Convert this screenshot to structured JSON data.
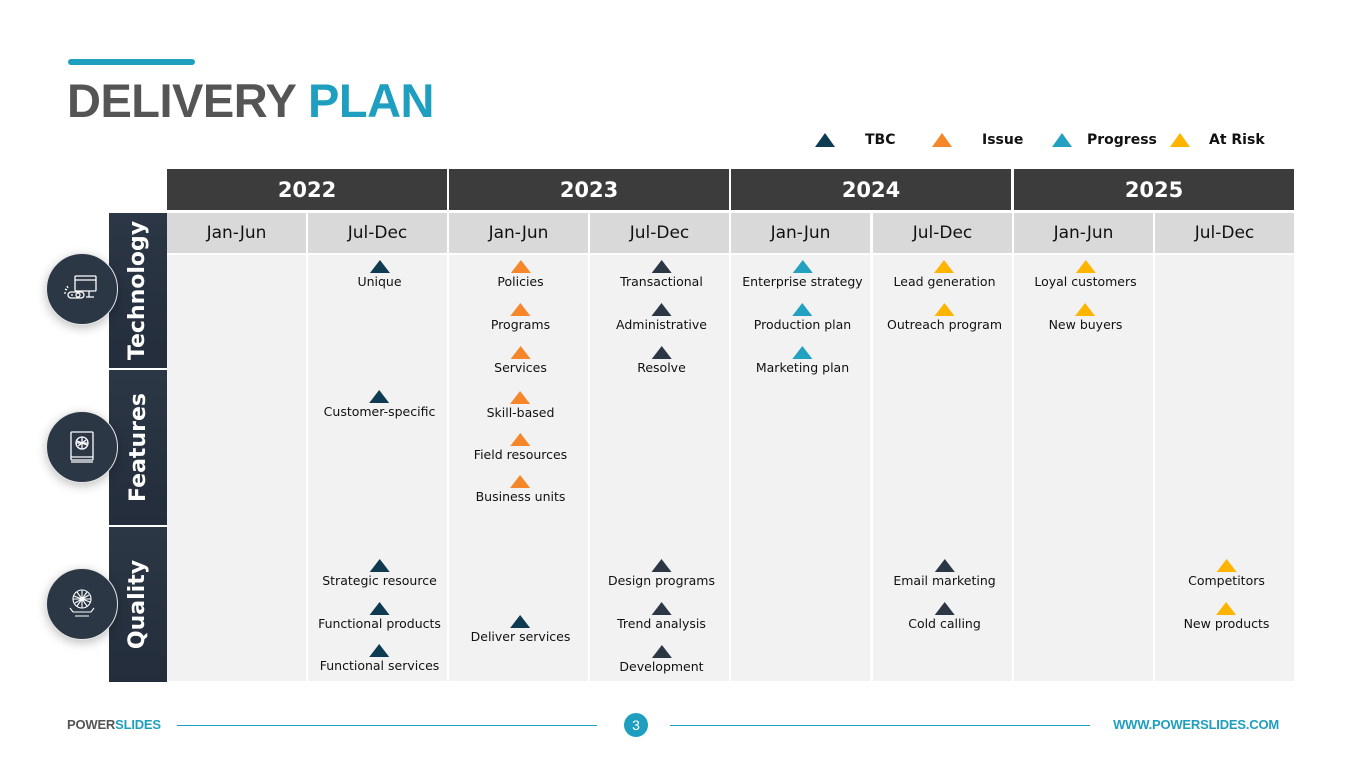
{
  "title": {
    "part1": "DELIVERY",
    "part2": "PLAN"
  },
  "colors": {
    "accent": "#1f9fbf",
    "tbc": "#0e3a52",
    "tbc_alt": "#2c3746",
    "issue": "#f5862a",
    "progress": "#22a2c0",
    "at_risk": "#ffb400"
  },
  "legend": [
    {
      "status": "tbc",
      "label": "TBC"
    },
    {
      "status": "issue",
      "label": "Issue"
    },
    {
      "status": "progress",
      "label": "Progress"
    },
    {
      "status": "at_risk",
      "label": "At Risk"
    }
  ],
  "years": [
    "2022",
    "2023",
    "2024",
    "2025"
  ],
  "halves": [
    "Jan-Jun",
    "Jul-Dec",
    "Jan-Jun",
    "Jul-Dec",
    "Jan-Jun",
    "Jul-Dec",
    "Jan-Jun",
    "Jul-Dec"
  ],
  "categories": [
    {
      "label": "Technology",
      "icon": "computer-icon"
    },
    {
      "label": "Features",
      "icon": "book-brain-icon"
    },
    {
      "label": "Quality",
      "icon": "brain-hand-icon"
    }
  ],
  "milestones": [
    {
      "label": "Unique",
      "period": 1,
      "category": 0,
      "slot": 0,
      "status": "tbc"
    },
    {
      "label": "Customer-specific",
      "period": 1,
      "category": 1,
      "slot": 0,
      "status": "tbc"
    },
    {
      "label": "Strategic resource",
      "period": 1,
      "category": 2,
      "slot": 0,
      "status": "tbc"
    },
    {
      "label": "Functional products",
      "period": 1,
      "category": 2,
      "slot": 1,
      "status": "tbc"
    },
    {
      "label": "Functional services",
      "period": 1,
      "category": 2,
      "slot": 2,
      "status": "tbc"
    },
    {
      "label": "Policies",
      "period": 2,
      "category": 0,
      "slot": 0,
      "status": "issue"
    },
    {
      "label": "Programs",
      "period": 2,
      "category": 0,
      "slot": 1,
      "status": "issue"
    },
    {
      "label": "Services",
      "period": 2,
      "category": 0,
      "slot": 2,
      "status": "issue"
    },
    {
      "label": "Skill-based",
      "period": 2,
      "category": 1,
      "slot": 0,
      "status": "issue"
    },
    {
      "label": "Field resources",
      "period": 2,
      "category": 1,
      "slot": 1,
      "status": "issue"
    },
    {
      "label": "Business units",
      "period": 2,
      "category": 1,
      "slot": 2,
      "status": "issue"
    },
    {
      "label": "Deliver services",
      "period": 2,
      "category": 2,
      "slot": 1.3,
      "status": "tbc"
    },
    {
      "label": "Transactional",
      "period": 3,
      "category": 0,
      "slot": 0,
      "status": "tbc_alt"
    },
    {
      "label": "Administrative",
      "period": 3,
      "category": 0,
      "slot": 1,
      "status": "tbc_alt"
    },
    {
      "label": "Resolve",
      "period": 3,
      "category": 0,
      "slot": 2,
      "status": "tbc_alt"
    },
    {
      "label": "Design programs",
      "period": 3,
      "category": 2,
      "slot": 0,
      "status": "tbc_alt"
    },
    {
      "label": "Trend analysis",
      "period": 3,
      "category": 2,
      "slot": 1,
      "status": "tbc_alt"
    },
    {
      "label": "Development",
      "period": 3,
      "category": 2,
      "slot": 2,
      "status": "tbc_alt"
    },
    {
      "label": "Enterprise strategy",
      "period": 4,
      "category": 0,
      "slot": 0,
      "status": "progress"
    },
    {
      "label": "Production plan",
      "period": 4,
      "category": 0,
      "slot": 1,
      "status": "progress"
    },
    {
      "label": "Marketing plan",
      "period": 4,
      "category": 0,
      "slot": 2,
      "status": "progress"
    },
    {
      "label": "Lead generation",
      "period": 5,
      "category": 0,
      "slot": 0,
      "status": "at_risk"
    },
    {
      "label": "Outreach program",
      "period": 5,
      "category": 0,
      "slot": 1,
      "status": "at_risk"
    },
    {
      "label": "Email marketing",
      "period": 5,
      "category": 2,
      "slot": 0,
      "status": "tbc_alt"
    },
    {
      "label": "Cold calling",
      "period": 5,
      "category": 2,
      "slot": 1,
      "status": "tbc_alt"
    },
    {
      "label": "Loyal customers",
      "period": 6,
      "category": 0,
      "slot": 0,
      "status": "at_risk"
    },
    {
      "label": "New buyers",
      "period": 6,
      "category": 0,
      "slot": 1,
      "status": "at_risk"
    },
    {
      "label": "Competitors",
      "period": 7,
      "category": 2,
      "slot": 0,
      "status": "at_risk"
    },
    {
      "label": "New products",
      "period": 7,
      "category": 2,
      "slot": 1,
      "status": "at_risk"
    }
  ],
  "footer": {
    "brand_part1": "POWER",
    "brand_part2": "SLIDES",
    "page_number": "3",
    "url": "WWW.POWERSLIDES.COM"
  }
}
